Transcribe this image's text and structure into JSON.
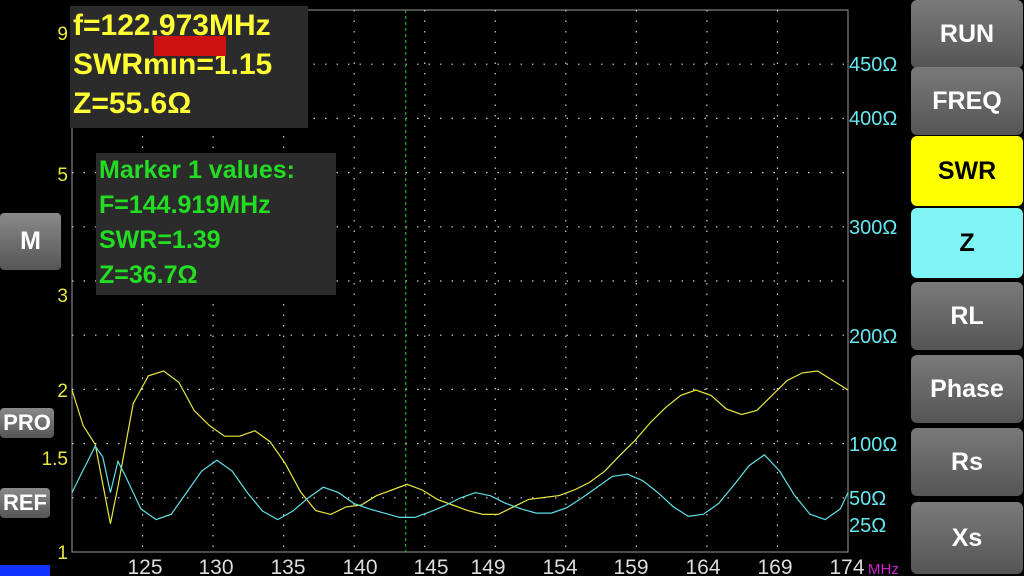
{
  "info": {
    "frequency": "f=122.973MHz",
    "swr_min": "SWRmin=1.15",
    "impedance": "Z=55.6Ω"
  },
  "marker": {
    "title": "Marker 1 values:",
    "frequency": "F=144.919MHz",
    "swr": "SWR=1.39",
    "impedance": "Z=36.7Ω"
  },
  "buttons": {
    "run": "RUN",
    "freq": "FREQ",
    "swr": "SWR",
    "z": "Z",
    "rl": "RL",
    "phase": "Phase",
    "rs": "Rs",
    "xs": "Xs",
    "marker": "M",
    "pro": "PRO",
    "ref": "REF"
  },
  "colors": {
    "swr_trace": "#e8e840",
    "z_trace": "#60e0e8",
    "marker_line": "#33cc33",
    "grid": "#d0d0d0",
    "freq_unit": "#cc22cc",
    "active_swr": "#ffff00",
    "active_z": "#7ff5f5"
  },
  "chart_data": {
    "type": "line",
    "x_unit": "MHz",
    "xlim": [
      122.973,
      174
    ],
    "x_ticks": [
      125,
      130,
      135,
      140,
      145,
      149,
      154,
      159,
      164,
      169,
      174
    ],
    "y_left_ticks": [
      "9",
      "5",
      "3",
      "2",
      "1.5",
      "1"
    ],
    "y_right_ticks": [
      "450Ω",
      "400Ω",
      "300Ω",
      "200Ω",
      "100Ω",
      "50Ω",
      "25Ω"
    ],
    "marker_x": 144.919,
    "series": [
      {
        "name": "SWR",
        "values": [
          [
            122.973,
            2.0
          ],
          [
            123.7,
            1.74
          ],
          [
            124.5,
            1.6
          ],
          [
            125.5,
            1.15
          ],
          [
            126,
            1.35
          ],
          [
            127,
            1.9
          ],
          [
            128,
            2.15
          ],
          [
            129,
            2.2
          ],
          [
            130,
            2.08
          ],
          [
            131,
            1.85
          ],
          [
            132,
            1.74
          ],
          [
            133,
            1.66
          ],
          [
            134,
            1.66
          ],
          [
            135,
            1.7
          ],
          [
            136,
            1.62
          ],
          [
            137,
            1.47
          ],
          [
            138,
            1.32
          ],
          [
            139,
            1.22
          ],
          [
            140,
            1.2
          ],
          [
            141,
            1.24
          ],
          [
            142,
            1.25
          ],
          [
            143,
            1.3
          ],
          [
            144,
            1.33
          ],
          [
            145,
            1.36
          ],
          [
            146,
            1.33
          ],
          [
            147,
            1.28
          ],
          [
            148,
            1.25
          ],
          [
            149,
            1.22
          ],
          [
            150,
            1.2
          ],
          [
            151,
            1.2
          ],
          [
            152,
            1.24
          ],
          [
            153,
            1.28
          ],
          [
            154,
            1.29
          ],
          [
            155,
            1.3
          ],
          [
            156,
            1.33
          ],
          [
            157,
            1.37
          ],
          [
            158,
            1.43
          ],
          [
            159,
            1.52
          ],
          [
            160,
            1.63
          ],
          [
            161,
            1.76
          ],
          [
            162,
            1.87
          ],
          [
            163,
            1.96
          ],
          [
            164,
            2.0
          ],
          [
            165,
            1.96
          ],
          [
            166,
            1.86
          ],
          [
            167,
            1.82
          ],
          [
            168,
            1.85
          ],
          [
            169,
            1.96
          ],
          [
            170,
            2.1
          ],
          [
            171,
            2.18
          ],
          [
            172,
            2.2
          ],
          [
            173,
            2.1
          ],
          [
            174,
            2.0
          ]
        ]
      },
      {
        "name": "Z",
        "values": [
          [
            122.973,
            55
          ],
          [
            123.5,
            70
          ],
          [
            124.5,
            98
          ],
          [
            125,
            88
          ],
          [
            125.5,
            55
          ],
          [
            126,
            84
          ],
          [
            126.5,
            70
          ],
          [
            127.5,
            40
          ],
          [
            128.5,
            30
          ],
          [
            129.5,
            35
          ],
          [
            130.5,
            55
          ],
          [
            131.5,
            75
          ],
          [
            132.5,
            85
          ],
          [
            133.5,
            75
          ],
          [
            134.5,
            55
          ],
          [
            135.5,
            38
          ],
          [
            136.5,
            30
          ],
          [
            137.5,
            38
          ],
          [
            138.5,
            50
          ],
          [
            139.5,
            60
          ],
          [
            140.5,
            55
          ],
          [
            141.5,
            45
          ],
          [
            142.5,
            40
          ],
          [
            143.5,
            36
          ],
          [
            144.5,
            32
          ],
          [
            145.5,
            32
          ],
          [
            146.5,
            37
          ],
          [
            147.5,
            43
          ],
          [
            148.5,
            50
          ],
          [
            149.5,
            55
          ],
          [
            150.5,
            52
          ],
          [
            151.5,
            45
          ],
          [
            152.5,
            40
          ],
          [
            153.5,
            36
          ],
          [
            154.5,
            36
          ],
          [
            155.5,
            41
          ],
          [
            156.5,
            50
          ],
          [
            157.5,
            60
          ],
          [
            158.5,
            70
          ],
          [
            159.5,
            72
          ],
          [
            160.5,
            66
          ],
          [
            161.5,
            55
          ],
          [
            162.5,
            42
          ],
          [
            163.5,
            33
          ],
          [
            164.5,
            35
          ],
          [
            165.5,
            45
          ],
          [
            166.5,
            62
          ],
          [
            167.5,
            80
          ],
          [
            168.5,
            90
          ],
          [
            169.5,
            75
          ],
          [
            170.5,
            52
          ],
          [
            171.5,
            35
          ],
          [
            172.5,
            30
          ],
          [
            173.5,
            40
          ],
          [
            174,
            55
          ]
        ]
      }
    ]
  }
}
